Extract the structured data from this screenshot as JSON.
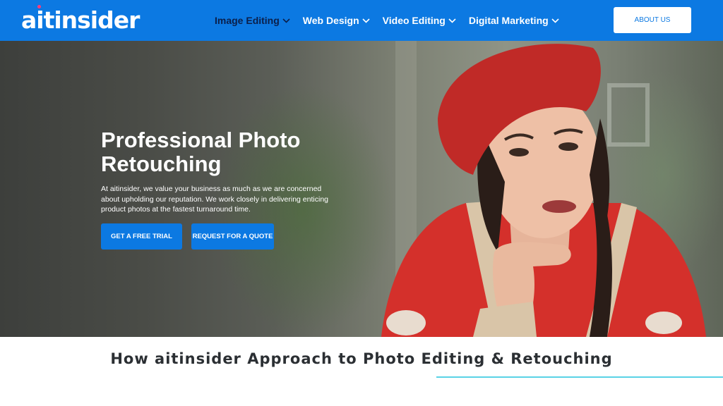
{
  "header": {
    "logo_text": "aitinsider",
    "nav": [
      {
        "label": "Image Editing",
        "active": true
      },
      {
        "label": "Web Design",
        "active": false
      },
      {
        "label": "Video Editing",
        "active": false
      },
      {
        "label": "Digital Marketing",
        "active": false
      }
    ],
    "about_label": "ABOUT US"
  },
  "hero": {
    "title": "Professional Photo Retouching",
    "description": "At aitinsider, we value your business as much as we are concerned about upholding our reputation. We work closely in delivering enticing product photos at the fastest turnaround time.",
    "cta_primary": "GET A FREE TRIAL",
    "cta_secondary": "REQUEST FOR A QUOTE"
  },
  "section": {
    "title": "How aitinsider Approach to Photo Editing & Retouching"
  },
  "colors": {
    "brand_blue": "#0c79e2",
    "active_nav": "#0b1f4a",
    "accent_line": "#5ad3e6"
  }
}
